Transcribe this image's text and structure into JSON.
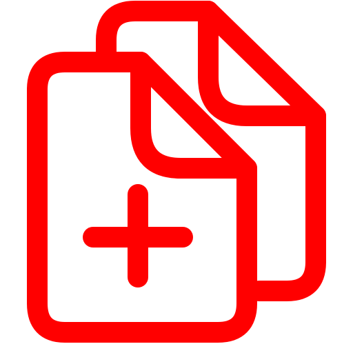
{
  "icon": {
    "name": "duplicate-file-add-icon",
    "stroke_color": "#ff0000",
    "background_color": "#ffffff"
  }
}
